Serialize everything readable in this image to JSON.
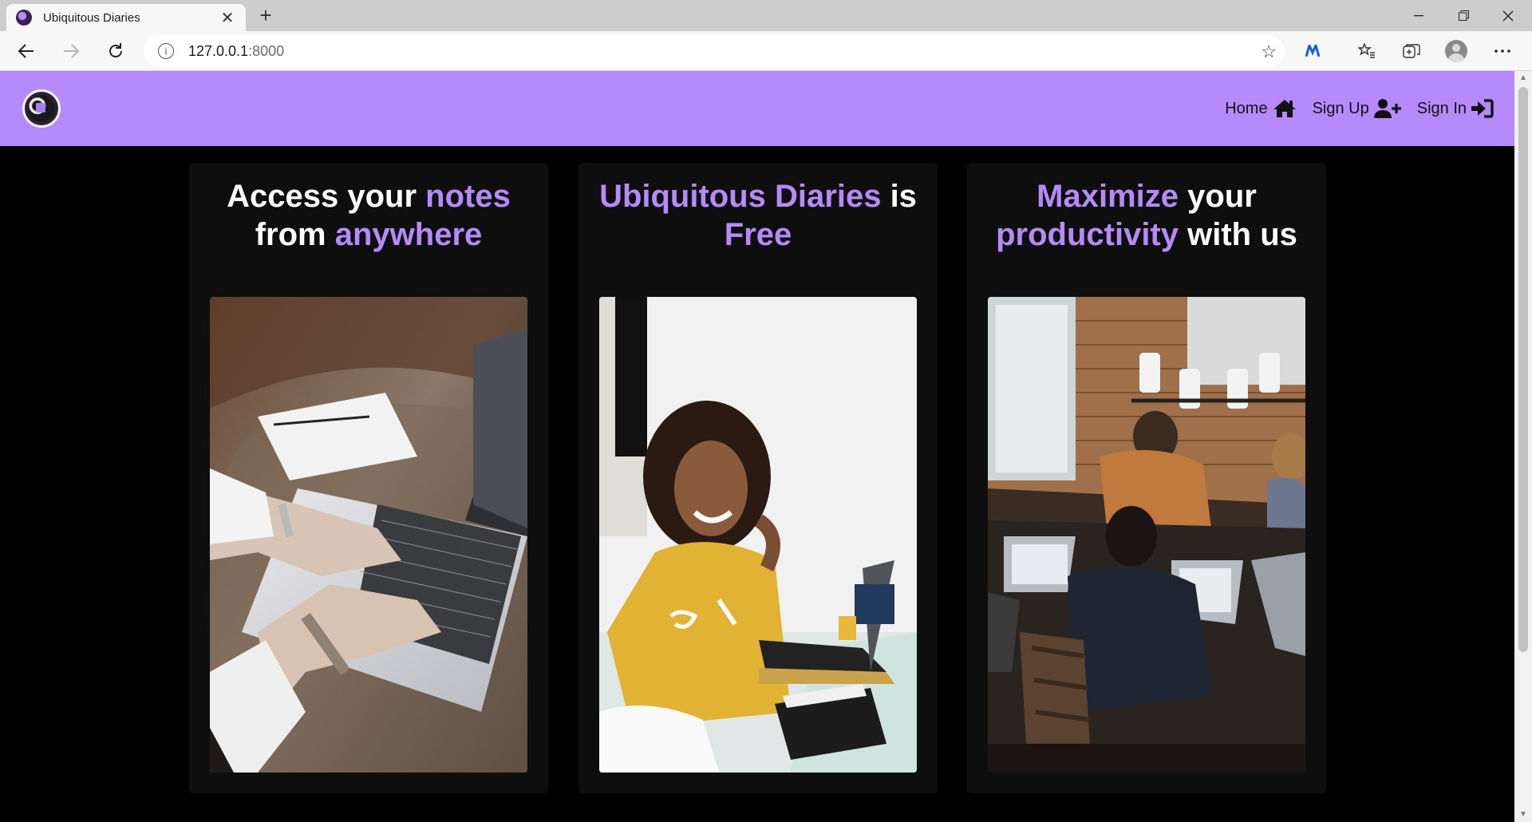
{
  "browser": {
    "tab_title": "Ubiquitous Diaries",
    "url_host": "127.0.0.1",
    "url_port": ":8000"
  },
  "nav": {
    "home": "Home",
    "signup": "Sign Up",
    "signin": "Sign In"
  },
  "cards": [
    {
      "part1": "Access your ",
      "hl1": "notes",
      "part2": " from ",
      "hl2": "anywhere",
      "image": "woman-typing-laptop-photo"
    },
    {
      "hl1": "Ubiquitous Diaries",
      "part1": " is ",
      "hl2": "Free",
      "image": "smiling-woman-yellow-sweater-photo"
    },
    {
      "hl1": "Maximize",
      "part1": " your ",
      "hl2": "productivity",
      "part2": " with us",
      "image": "team-working-laptops-photo"
    }
  ],
  "colors": {
    "accent": "#b78afc",
    "page_bg": "#000000",
    "card_bg": "#0e0e0e"
  }
}
